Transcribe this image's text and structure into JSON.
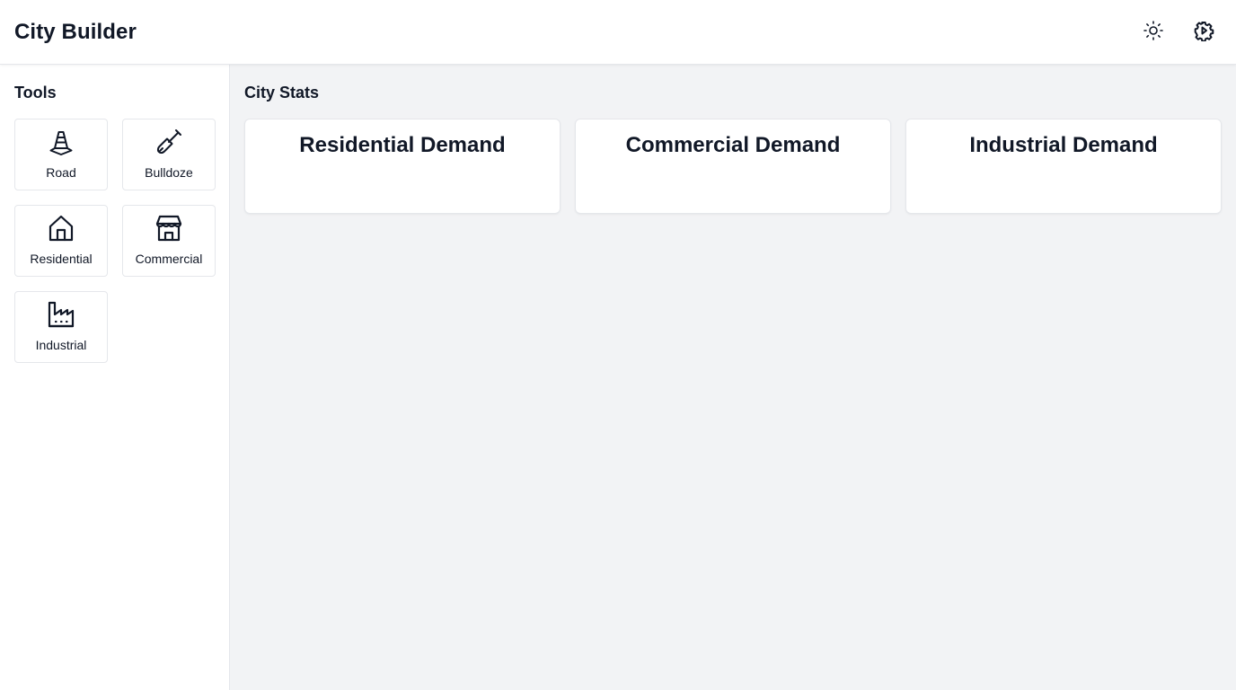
{
  "app": {
    "title": "City Builder"
  },
  "header": {
    "theme_toggle_icon": "sun-icon",
    "settings_icon": "gear-icon"
  },
  "sidebar": {
    "title": "Tools",
    "tools": [
      {
        "label": "Road",
        "icon": "traffic-cone-icon"
      },
      {
        "label": "Bulldoze",
        "icon": "shovel-icon"
      },
      {
        "label": "Residential",
        "icon": "house-icon"
      },
      {
        "label": "Commercial",
        "icon": "store-icon"
      },
      {
        "label": "Industrial",
        "icon": "factory-icon"
      }
    ]
  },
  "main": {
    "title": "City Stats",
    "cards": [
      {
        "title": "Residential Demand"
      },
      {
        "title": "Commercial Demand"
      },
      {
        "title": "Industrial Demand"
      }
    ]
  },
  "colors": {
    "text": "#111827",
    "border": "#e5e7eb",
    "main_background": "#f2f3f5",
    "panel_background": "#ffffff"
  }
}
